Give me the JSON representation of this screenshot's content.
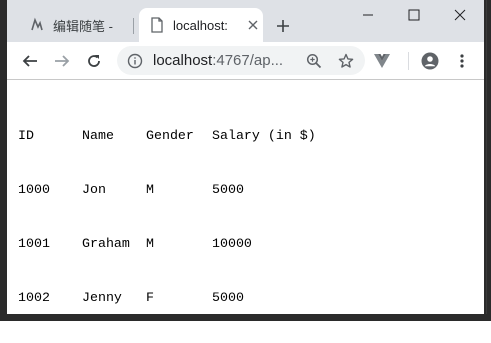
{
  "browser": {
    "tabs": [
      {
        "title": "编辑随笔 - ",
        "active": false
      },
      {
        "title": "localhost:",
        "active": true
      }
    ],
    "url_host": "localhost",
    "url_rest": ":4767/ap...",
    "new_tab_label": "+"
  },
  "page": {
    "headers": [
      "ID",
      "Name",
      "Gender",
      "Salary (in $)"
    ],
    "rows": [
      [
        "1000",
        "Jon",
        "M",
        "5000"
      ],
      [
        "1001",
        "Graham",
        "M",
        "10000"
      ],
      [
        "1002",
        "Jenny",
        "F",
        "5000"
      ]
    ]
  },
  "colors": {
    "tabstrip": "#dee1e6",
    "omnibox": "#f1f3f4",
    "frame": "#2b2b2b"
  },
  "icons": [
    "ui-logo-icon",
    "document-icon",
    "close-icon",
    "plus-icon",
    "minimize-icon",
    "maximize-icon",
    "close-window-icon",
    "back-arrow-icon",
    "forward-arrow-icon",
    "reload-icon",
    "info-icon",
    "zoom-icon",
    "star-icon",
    "vue-devtools-icon",
    "account-icon",
    "menu-dots-icon"
  ]
}
